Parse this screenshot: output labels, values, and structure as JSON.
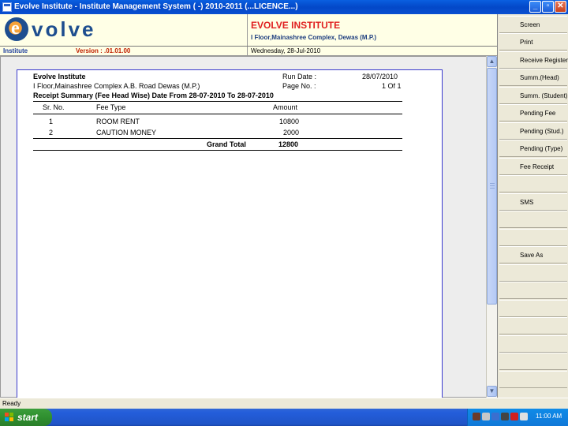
{
  "window": {
    "title": "Evolve Institute - Institute Management System ( -) 2010-2011 (...LICENCE...)",
    "min_label": "_",
    "max_label": "▫",
    "close_label": "✕"
  },
  "header": {
    "logo_letter": "e",
    "logo_word": "volve",
    "institute_name": "EVOLVE INSTITUTE",
    "institute_address": "I Floor,Mainashree Complex, Dewas (M.P.)",
    "label": "Institute",
    "version": "Version : .01.01.00",
    "date": "Wednesday, 28-Jul-2010"
  },
  "report": {
    "org": "Evolve Institute",
    "address": "I Floor,Mainashree Complex A.B. Road Dewas (M.P.)",
    "run_date_label": "Run Date :",
    "run_date": "28/07/2010",
    "page_label": "Page No. :",
    "page_value": "1 Of 1",
    "heading": "Receipt Summary (Fee Head Wise) Date From 28-07-2010 To 28-07-2010",
    "columns": {
      "sr": "Sr. No.",
      "fee_type": "Fee Type",
      "amount": "Amount"
    },
    "rows": [
      {
        "sr": "1",
        "fee_type": "ROOM RENT",
        "amount": "10800"
      },
      {
        "sr": "2",
        "fee_type": "CAUTION MONEY",
        "amount": "2000"
      }
    ],
    "total_label": "Grand Total",
    "total_value": "12800"
  },
  "side_buttons": [
    "Screen",
    "Print",
    "Receive Register",
    "Summ.(Head)",
    "Summ. (Student)",
    "Pending Fee",
    "Pending (Stud.)",
    "Pending (Type)",
    "Fee Receipt",
    "",
    "SMS",
    "",
    "",
    "Save As",
    "",
    "",
    "",
    "",
    "",
    "",
    ""
  ],
  "status": {
    "text": "Ready"
  },
  "taskbar": {
    "start_label": "start",
    "clock": "11:00 AM"
  }
}
